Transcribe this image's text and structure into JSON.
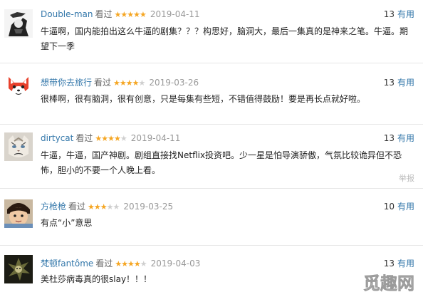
{
  "reviews": [
    {
      "author": "Double-man",
      "action": "看过",
      "stars_on": "★★★★★",
      "stars_off": "",
      "date": "2019-04-11",
      "votes": "13",
      "useful_label": "有用",
      "content": "牛逼啊，国内能拍出这么牛逼的剧集？？？构思好，脑洞大，最后一集真的是神来之笔。牛逼。期望下一季",
      "avatar_icon": "illustrated-person-avatar"
    },
    {
      "author": "想带你去旅行",
      "action": "看过",
      "stars_on": "★★★★",
      "stars_off": "★",
      "date": "2019-03-26",
      "votes": "13",
      "useful_label": "有用",
      "content": "很棒啊，很有脑洞，很有创意，只是每集有些短，不错值得鼓励！要是再长点就好啦。",
      "avatar_icon": "red-fox-cartoon-avatar"
    },
    {
      "author": "dirtycat",
      "action": "看过",
      "stars_on": "★★★★",
      "stars_off": "★",
      "date": "2019-04-11",
      "votes": "13",
      "useful_label": "有用",
      "content": "牛逼，牛逼，国产神剧。剧组直接找Netflix投资吧。少一星是怕导演骄傲，气氛比较诡异但不恐怖，胆小的不要一个人晚上看。",
      "report_label": "举报",
      "avatar_icon": "grumpy-cat-avatar"
    },
    {
      "author": "方枪枪",
      "action": "看过",
      "stars_on": "★★★",
      "stars_off": "★★",
      "date": "2019-03-25",
      "votes": "10",
      "useful_label": "有用",
      "content": "有点“小”意思",
      "avatar_icon": "child-photo-avatar"
    },
    {
      "author": "梵顿fantôme",
      "action": "看过",
      "stars_on": "★★★★",
      "stars_off": "★",
      "date": "2019-04-03",
      "votes": "13",
      "useful_label": "有用",
      "content": "美杜莎病毒真的很slay！！！",
      "avatar_icon": "dark-creature-avatar"
    }
  ],
  "watermark_text": "觅趣网"
}
